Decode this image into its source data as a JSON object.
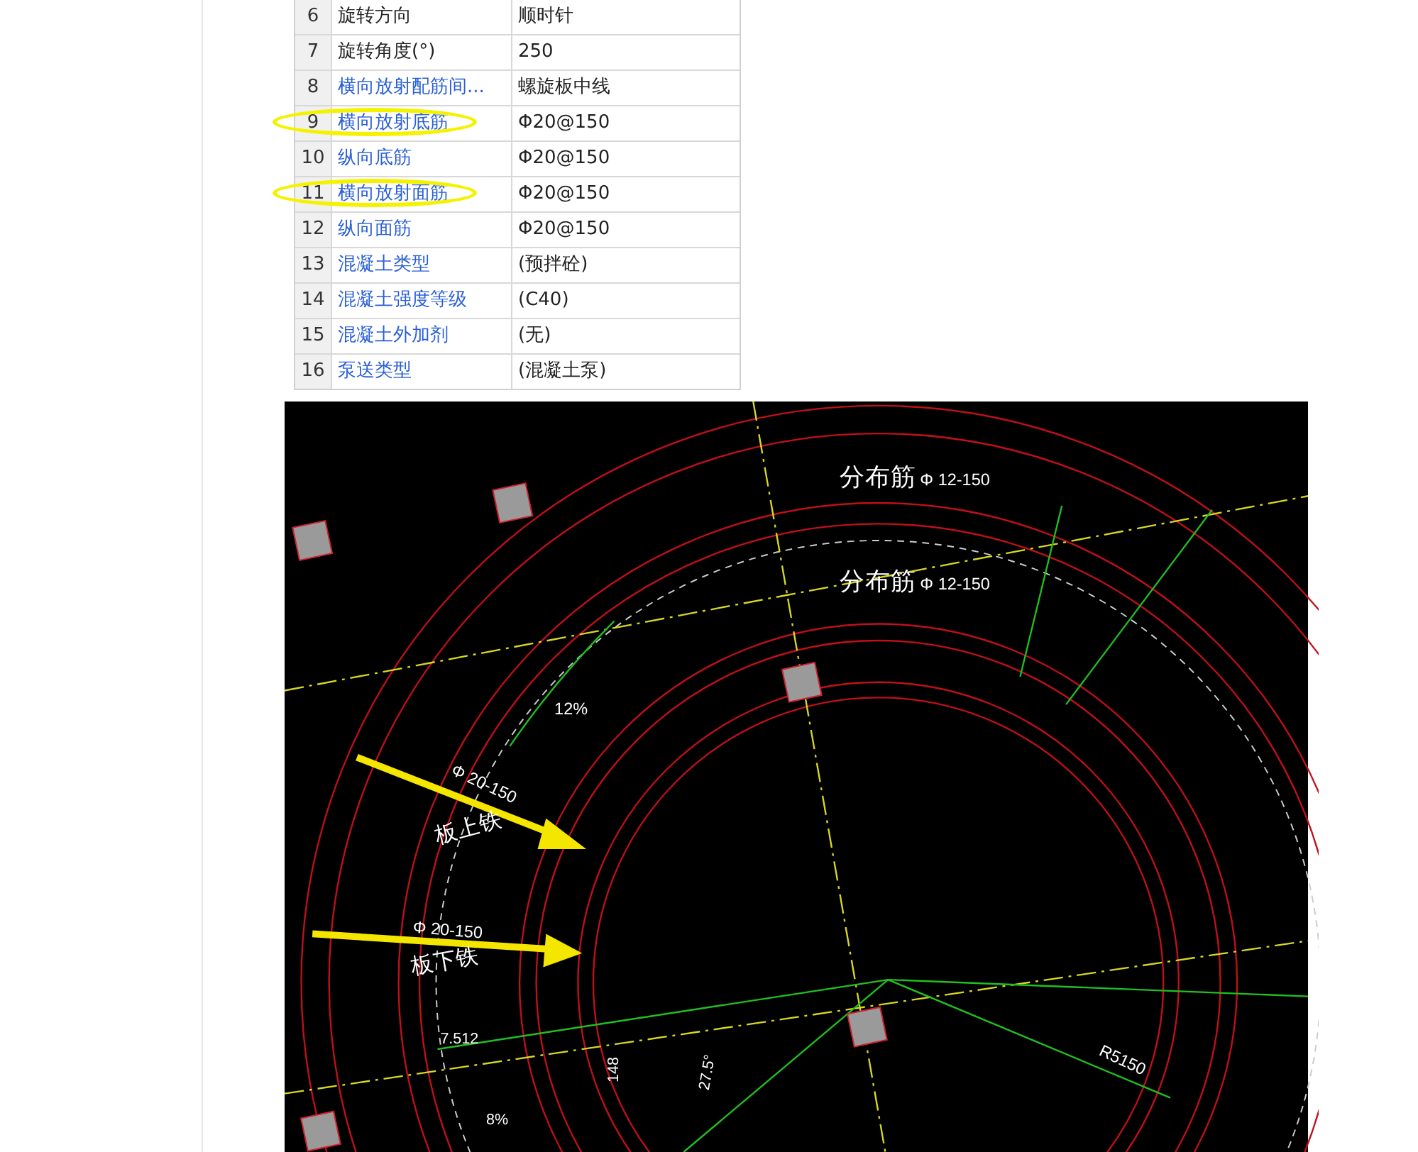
{
  "property_table": {
    "rows": [
      {
        "number": "6",
        "name": "旋转方向",
        "value": "顺时针",
        "link": false,
        "highlighted": false
      },
      {
        "number": "7",
        "name": "旋转角度(°)",
        "value": "250",
        "link": false,
        "highlighted": false
      },
      {
        "number": "8",
        "name": "横向放射配筋间...",
        "value": "螺旋板中线",
        "link": true,
        "highlighted": false
      },
      {
        "number": "9",
        "name": "横向放射底筋",
        "value": "Φ20@150",
        "link": true,
        "highlighted": true
      },
      {
        "number": "10",
        "name": "纵向底筋",
        "value": "Φ20@150",
        "link": true,
        "highlighted": false
      },
      {
        "number": "11",
        "name": "横向放射面筋",
        "value": "Φ20@150",
        "link": true,
        "highlighted": true
      },
      {
        "number": "12",
        "name": "纵向面筋",
        "value": "Φ20@150",
        "link": true,
        "highlighted": false
      },
      {
        "number": "13",
        "name": "混凝土类型",
        "value": "(预拌砼)",
        "link": true,
        "highlighted": false
      },
      {
        "number": "14",
        "name": "混凝土强度等级",
        "value": "(C40)",
        "link": true,
        "highlighted": false
      },
      {
        "number": "15",
        "name": "混凝土外加剂",
        "value": "(无)",
        "link": true,
        "highlighted": false
      },
      {
        "number": "16",
        "name": "泵送类型",
        "value": "(混凝土泵)",
        "link": true,
        "highlighted": false
      }
    ]
  },
  "cad_drawing": {
    "labels": [
      "分布筋",
      "Φ 12-150",
      "分布筋",
      "Φ 12-150",
      "12%",
      "Φ 20-150",
      "板上铁",
      "Φ 20-150",
      "板下铁",
      "7.512",
      "148",
      "27.5°",
      "R5150",
      "8%"
    ]
  }
}
